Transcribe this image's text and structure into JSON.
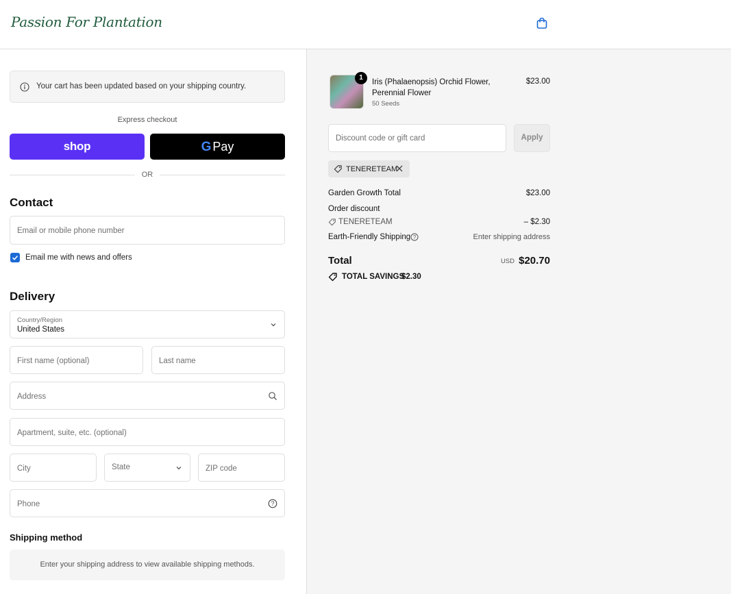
{
  "header": {
    "logo_text": "Passion For Plantation",
    "cart_icon": "shopping-bag-icon"
  },
  "notice": {
    "icon": "info-icon",
    "text": "Your cart has been updated based on your shipping country."
  },
  "express": {
    "label": "Express checkout",
    "shop_pay_label": "shop",
    "gpay_g": "G",
    "gpay_label": "Pay",
    "or_label": "OR"
  },
  "contact": {
    "heading": "Contact",
    "email_placeholder": "Email or mobile phone number",
    "newsletter_label": "Email me with news and offers",
    "newsletter_checked": true
  },
  "delivery": {
    "heading": "Delivery",
    "country_label": "Country/Region",
    "country_value": "United States",
    "first_name_placeholder": "First name (optional)",
    "last_name_placeholder": "Last name",
    "address_placeholder": "Address",
    "apartment_placeholder": "Apartment, suite, etc. (optional)",
    "city_placeholder": "City",
    "state_placeholder": "State",
    "zip_placeholder": "ZIP code",
    "phone_placeholder": "Phone"
  },
  "shipping_method": {
    "heading": "Shipping method",
    "message": "Enter your shipping address to view available shipping methods."
  },
  "summary": {
    "product": {
      "name": "Iris (Phalaenopsis) Orchid Flower, Perennial Flower",
      "variant": "50 Seeds",
      "price": "$23.00",
      "quantity": "1"
    },
    "discount_placeholder": "Discount code or gift card",
    "apply_label": "Apply",
    "applied_code": "TENERETEAM",
    "subtotal_label": "Garden Growth Total",
    "subtotal_value": "$23.00",
    "order_discount_label": "Order discount",
    "discount_code": "TENERETEAM",
    "discount_value": "– $2.30",
    "shipping_label": "Earth-Friendly Shipping",
    "shipping_value": "Enter shipping address",
    "total_label": "Total",
    "currency": "USD",
    "total_value": "$20.70",
    "savings_label": "TOTAL SAVINGS",
    "savings_value": "$2.30"
  },
  "colors": {
    "shop_pay": "#5a31f4",
    "gpay": "#000000",
    "checkbox": "#1c6ad6",
    "summary_bg": "#f5f5f5",
    "logo": "#1f5b3c"
  }
}
